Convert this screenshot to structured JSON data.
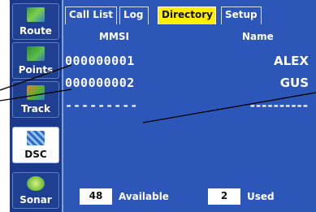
{
  "menu": {
    "items": [
      {
        "label": "Route",
        "icon": "route-icon"
      },
      {
        "label": "Points",
        "icon": "points-icon"
      },
      {
        "label": "Track",
        "icon": "track-icon"
      },
      {
        "label": "DSC",
        "icon": "dsc-icon",
        "selected": true
      },
      {
        "label": "Sonar",
        "icon": "sonar-icon"
      }
    ]
  },
  "tabs": [
    {
      "label": "Call List"
    },
    {
      "label": "Log"
    },
    {
      "label": "Directory",
      "active": true
    },
    {
      "label": "Setup"
    }
  ],
  "directory": {
    "headers": {
      "mmsi": "MMSI",
      "name": "Name"
    },
    "rows": [
      {
        "mmsi": "000000001",
        "name": "ALEX"
      },
      {
        "mmsi": "000000002",
        "name": "GUS"
      },
      {
        "mmsi": "---------",
        "name": "----------"
      }
    ]
  },
  "status": {
    "available_count": "48",
    "available_label": "Available",
    "used_count": "2",
    "used_label": "Used"
  },
  "colors": {
    "panel": "#2c57b8",
    "menu": "#1b3a8c",
    "active_tab": "#ffee00"
  }
}
